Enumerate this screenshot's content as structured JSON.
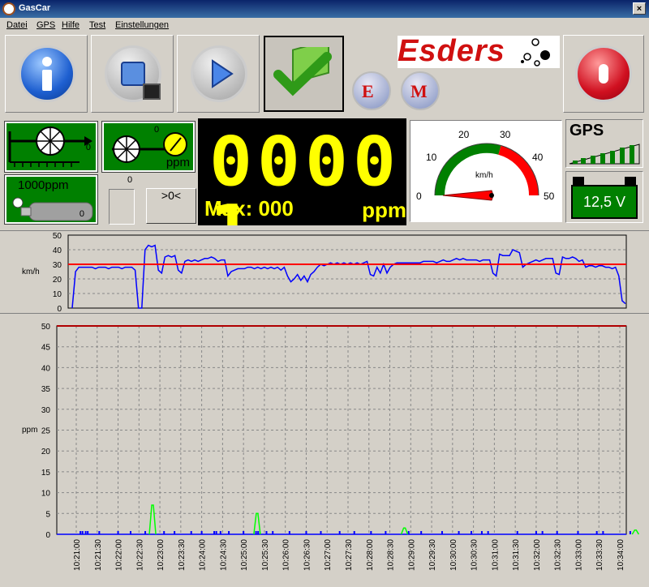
{
  "window": {
    "title": "GasCar",
    "close_glyph": "×"
  },
  "menu": [
    "Datei",
    "GPS",
    "Hilfe",
    "Test",
    "Einstellungen"
  ],
  "logo": {
    "text": "Esders"
  },
  "toolbar": {
    "info_icon": "info-icon",
    "stop_icon": "stop-save-icon",
    "play_icon": "play-icon",
    "check_icon": "checkmark-icon",
    "e_label": "E",
    "m_label": "M",
    "power_icon": "power-icon"
  },
  "sensors": {
    "pump_count": "0",
    "ppm_count": "0",
    "ppm_unit": "ppm",
    "cal_gas_label": "1000ppm",
    "cal_gas_count": "0",
    "zero_label": "0",
    "zero_button": ">0<"
  },
  "display": {
    "digits": "0000 1",
    "max_label": "Max: 000",
    "unit": "ppm"
  },
  "speedometer": {
    "unit": "km/h",
    "ticks": [
      "0",
      "10",
      "20",
      "30",
      "40",
      "50"
    ],
    "value": 0,
    "max": 50,
    "colors": {
      "green": "#008000",
      "red": "#ff0000"
    }
  },
  "status": {
    "gps_label": "GPS",
    "gps_bars": 6,
    "battery_label": "12,5 V"
  },
  "colors": {
    "panel_green": "#008000",
    "display_yellow": "#ffff00",
    "series_blue": "#0000ff",
    "threshold_red": "#ff0000",
    "gas_green": "#00ff00"
  },
  "chart_data": [
    {
      "type": "line",
      "ylabel": "km/h",
      "ylim": [
        0,
        50
      ],
      "yticks": [
        "0",
        "10",
        "20",
        "30",
        "40",
        "50"
      ],
      "grid": true,
      "threshold": 30,
      "series": [
        {
          "values": [
            0,
            25,
            28,
            28,
            28,
            28,
            28,
            27,
            28,
            28,
            28,
            27,
            28,
            28,
            28,
            27,
            28,
            28,
            28,
            26,
            0,
            0,
            40,
            43,
            42,
            43,
            26,
            24,
            35,
            36,
            35,
            36,
            26,
            24,
            32,
            33,
            32,
            33,
            32,
            33,
            34,
            34,
            35,
            34,
            32,
            33,
            33,
            22,
            25,
            26,
            27,
            27,
            27,
            28,
            28,
            27,
            28,
            27,
            28,
            27,
            28,
            27,
            28,
            26,
            28,
            22,
            18,
            20,
            23,
            19,
            22,
            18,
            23,
            25,
            28,
            30,
            29,
            30,
            31,
            30,
            31,
            30,
            31,
            30,
            31,
            30,
            31,
            30,
            31,
            32,
            23,
            22,
            28,
            24,
            30,
            24,
            28,
            30,
            31,
            31,
            31,
            31,
            31,
            31,
            31,
            31,
            32,
            32,
            32,
            32,
            31,
            32,
            33,
            32,
            32,
            33,
            34,
            33,
            34,
            33,
            33,
            33,
            33,
            32,
            33,
            33,
            33,
            24,
            22,
            37,
            36,
            36,
            36,
            40,
            39,
            38,
            28,
            30,
            31,
            32,
            33,
            32,
            33,
            34,
            34,
            34,
            24,
            23,
            35,
            34,
            34,
            35,
            34,
            32,
            33,
            28,
            29,
            29,
            28,
            29,
            29,
            28,
            28,
            27,
            28,
            22,
            5,
            3
          ]
        }
      ]
    },
    {
      "type": "line",
      "ylabel": "ppm",
      "ylim": [
        0,
        50
      ],
      "yticks": [
        "0",
        "5",
        "10",
        "15",
        "20",
        "25",
        "30",
        "35",
        "40",
        "45",
        "50"
      ],
      "grid": true,
      "threshold": 50,
      "categories": [
        "10:21:00",
        "10:21:30",
        "10:22:00",
        "10:22:30",
        "10:23:00",
        "10:23:30",
        "10:24:00",
        "10:24:30",
        "10:25:00",
        "10:25:30",
        "10:26:00",
        "10:26:30",
        "10:27:00",
        "10:27:30",
        "10:28:00",
        "10:28:30",
        "10:29:00",
        "10:29:30",
        "10:30:00",
        "10:30:30",
        "10:31:00",
        "10:31:30",
        "10:32:00",
        "10:32:30",
        "10:33:00",
        "10:33:30",
        "10:34:00"
      ],
      "gas_spikes": [
        {
          "x": 3.65,
          "y": 7
        },
        {
          "x": 8.65,
          "y": 5
        },
        {
          "x": 15.7,
          "y": 1.5
        },
        {
          "x": 26.75,
          "y": 1
        }
      ],
      "blue_ticks": [
        0.2,
        0.3,
        0.45,
        0.55,
        1.1,
        2.0,
        2.6,
        3.3,
        4.2,
        4.7,
        5.5,
        6.0,
        6.6,
        6.7,
        6.9,
        7.3,
        8.0,
        8.6,
        8.7,
        9.1,
        9.4,
        10.2,
        11.0,
        11.7,
        12.6,
        13.3,
        14.1,
        14.8,
        15.9,
        16.5,
        17.5,
        18.3,
        18.9,
        19.4,
        19.7,
        21.1,
        22.0,
        22.3,
        23.0,
        24.0,
        24.9,
        25.2,
        26.5
      ]
    }
  ]
}
